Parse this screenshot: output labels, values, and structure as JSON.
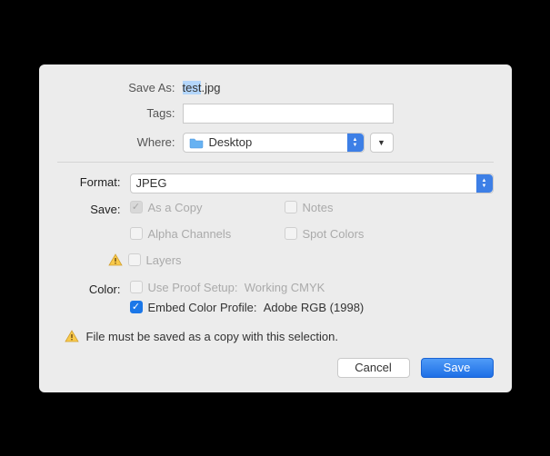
{
  "labels": {
    "saveAs": "Save As:",
    "tags": "Tags:",
    "where": "Where:",
    "format": "Format:",
    "save": "Save:",
    "color": "Color:"
  },
  "fields": {
    "saveAs": {
      "value": "test.jpg",
      "selectedPrefix": "test",
      "suffix": ".jpg"
    },
    "tags": {
      "value": ""
    },
    "where": "Desktop"
  },
  "format": "JPEG",
  "options": {
    "asACopy": "As a Copy",
    "notes": "Notes",
    "alphaChannels": "Alpha Channels",
    "spotColors": "Spot Colors",
    "layers": "Layers",
    "useProofSetup": "Use Proof Setup:",
    "proofSetupValue": "Working CMYK",
    "embedProfile": "Embed Color Profile:",
    "embedProfileValue": "Adobe RGB (1998)"
  },
  "warningNote": "File must be saved as a copy with this selection.",
  "buttons": {
    "cancel": "Cancel",
    "save": "Save"
  }
}
